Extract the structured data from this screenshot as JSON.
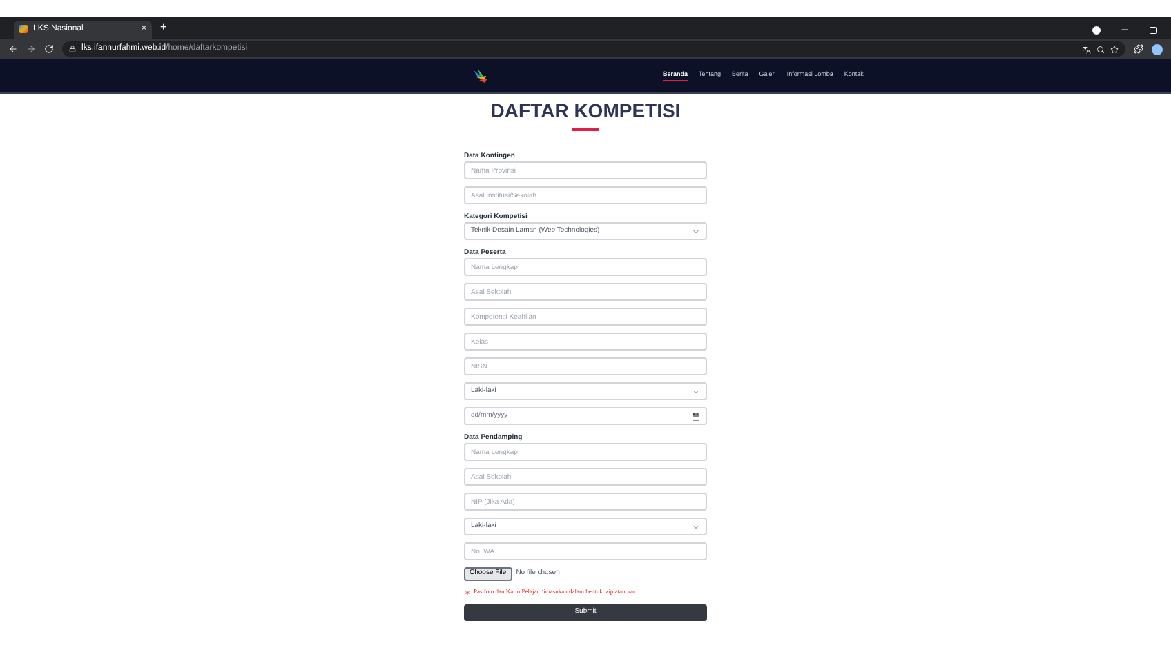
{
  "browser": {
    "tab_title": "LKS Nasional",
    "tab_close": "×",
    "new_tab": "+",
    "url_host": "lks.ifannurfahmi.web.id",
    "url_path": "/home/daftarkompetisi"
  },
  "nav": {
    "items": [
      {
        "label": "Beranda",
        "selected": true
      },
      {
        "label": "Tentang",
        "selected": false
      },
      {
        "label": "Berita",
        "selected": false
      },
      {
        "label": "Galeri",
        "selected": false
      },
      {
        "label": "Informasi Lomba",
        "selected": false
      },
      {
        "label": "Kontak",
        "selected": false
      }
    ]
  },
  "title": "DAFTAR KOMPETISI",
  "sections": [
    {
      "label": "Data Kontingen",
      "fields": [
        {
          "kind": "text",
          "placeholder": "Nama Provinsi"
        },
        {
          "kind": "text",
          "placeholder": "Asal Institusi/Sekolah"
        }
      ]
    },
    {
      "label": "Kategori Kompetisi",
      "fields": [
        {
          "kind": "select",
          "value": "Teknik Desain Laman (Web Technologies)"
        }
      ]
    },
    {
      "label": "Data Peserta",
      "fields": [
        {
          "kind": "text",
          "placeholder": "Nama Lengkap"
        },
        {
          "kind": "text",
          "placeholder": "Asal Sekolah"
        },
        {
          "kind": "text",
          "placeholder": "Kompetensi Keahlian"
        },
        {
          "kind": "text",
          "placeholder": "Kelas"
        },
        {
          "kind": "text",
          "placeholder": "NISN"
        },
        {
          "kind": "select",
          "value": "Laki-laki"
        },
        {
          "kind": "date",
          "placeholder": "dd/mm/yyyy"
        }
      ]
    },
    {
      "label": "Data Pendamping",
      "fields": [
        {
          "kind": "text",
          "placeholder": "Nama Lengkap"
        },
        {
          "kind": "text",
          "placeholder": "Asal Sekolah"
        },
        {
          "kind": "text",
          "placeholder": "NIP (Jika Ada)"
        },
        {
          "kind": "select",
          "value": "Laki-laki"
        },
        {
          "kind": "text",
          "placeholder": "No. WA"
        }
      ]
    }
  ],
  "file": {
    "button": "Choose File",
    "status": "No file chosen"
  },
  "note": "Pas foto dan Kartu Pelajar dimasukan dalam bentuk .zip atau .rar",
  "submit": "Submit"
}
